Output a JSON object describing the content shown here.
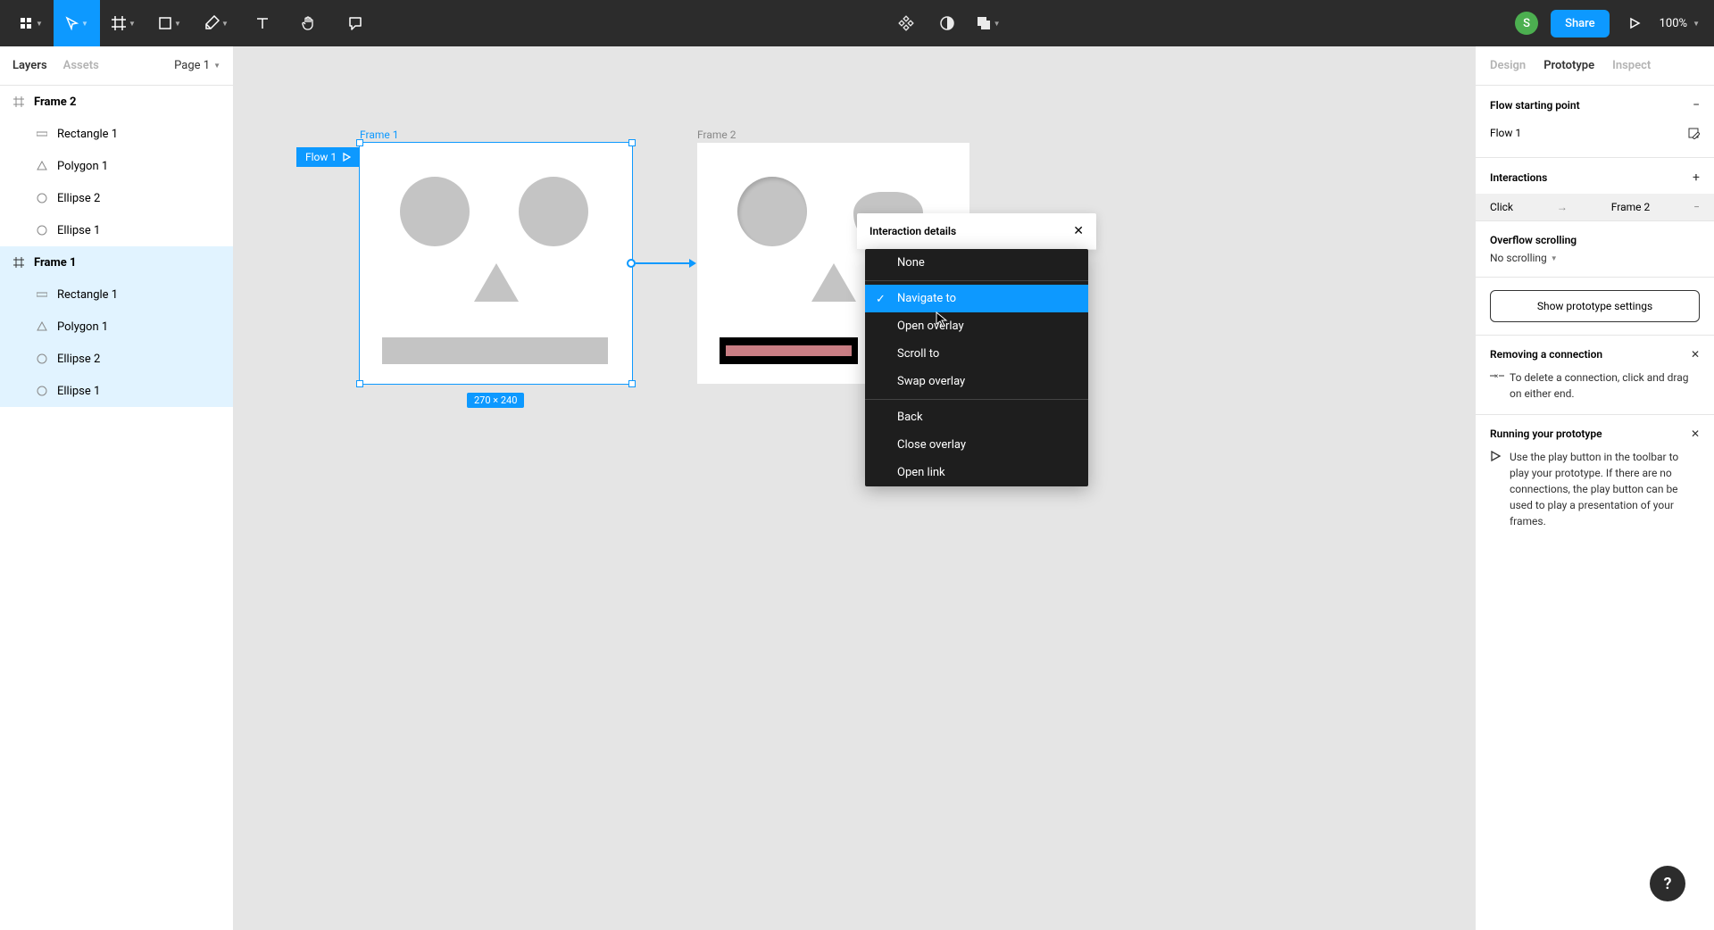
{
  "toolbar": {
    "share_label": "Share",
    "zoom": "100%",
    "avatar_initial": "S"
  },
  "left_panel": {
    "tabs": {
      "layers": "Layers",
      "assets": "Assets"
    },
    "page_label": "Page 1",
    "layers": [
      {
        "name": "Frame 2",
        "type": "frame"
      },
      {
        "name": "Rectangle 1",
        "type": "rect"
      },
      {
        "name": "Polygon 1",
        "type": "polygon"
      },
      {
        "name": "Ellipse 2",
        "type": "ellipse"
      },
      {
        "name": "Ellipse 1",
        "type": "ellipse"
      },
      {
        "name": "Frame 1",
        "type": "frame"
      },
      {
        "name": "Rectangle 1",
        "type": "rect"
      },
      {
        "name": "Polygon 1",
        "type": "polygon"
      },
      {
        "name": "Ellipse 2",
        "type": "ellipse"
      },
      {
        "name": "Ellipse 1",
        "type": "ellipse"
      }
    ]
  },
  "canvas": {
    "frame1_label": "Frame 1",
    "frame2_label": "Frame 2",
    "flow_label": "Flow 1",
    "dimensions": "270 × 240"
  },
  "interaction_details": {
    "title": "Interaction details"
  },
  "dropdown": {
    "none": "None",
    "navigate_to": "Navigate to",
    "open_overlay": "Open overlay",
    "scroll_to": "Scroll to",
    "swap_overlay": "Swap overlay",
    "back": "Back",
    "close_overlay": "Close overlay",
    "open_link": "Open link"
  },
  "right_panel": {
    "tabs": {
      "design": "Design",
      "prototype": "Prototype",
      "inspect": "Inspect"
    },
    "flow_starting_point": "Flow starting point",
    "flow_name": "Flow 1",
    "interactions": "Interactions",
    "interaction_trigger": "Click",
    "interaction_target": "Frame 2",
    "overflow_scrolling": "Overflow scrolling",
    "no_scrolling": "No scrolling",
    "show_proto_settings": "Show prototype settings",
    "removing_connection": "Removing a connection",
    "removing_text": "To delete a connection, click and drag on either end.",
    "running_prototype": "Running your prototype",
    "running_text": "Use the play button in the toolbar to play your prototype. If there are no connections, the play button can be used to play a presentation of your frames."
  }
}
